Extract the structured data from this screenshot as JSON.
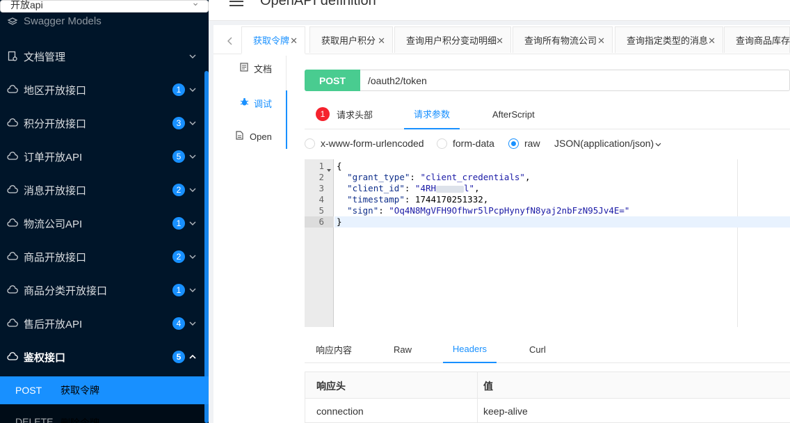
{
  "group_select": {
    "value": "开放api"
  },
  "sidebar": {
    "partial_item": "Swagger Models",
    "items": [
      {
        "label": "文档管理",
        "badge": ""
      },
      {
        "label": "地区开放接口",
        "badge": "1"
      },
      {
        "label": "积分开放接口",
        "badge": "3"
      },
      {
        "label": "订单开放API",
        "badge": "5"
      },
      {
        "label": "消息开放接口",
        "badge": "2"
      },
      {
        "label": "物流公司API",
        "badge": "1"
      },
      {
        "label": "商品开放接口",
        "badge": "2"
      },
      {
        "label": "商品分类开放接口",
        "badge": "1"
      },
      {
        "label": "售后开放API",
        "badge": "4"
      },
      {
        "label": "鉴权接口",
        "badge": "5"
      }
    ],
    "sub_active": {
      "method": "POST",
      "name": "获取令牌"
    },
    "sub_next": {
      "method": "DELETE",
      "name": "删除令牌"
    }
  },
  "header": {
    "title": "OpenAPI definition"
  },
  "tabs": [
    {
      "label": "获取令牌"
    },
    {
      "label": "获取用户积分"
    },
    {
      "label": "查询用户积分变动明细"
    },
    {
      "label": "查询所有物流公司"
    },
    {
      "label": "查询指定类型的消息"
    },
    {
      "label": "查询商品库存"
    }
  ],
  "vertical_tabs": [
    {
      "label": "文档",
      "icon": "document-icon"
    },
    {
      "label": "调试",
      "icon": "bug-icon"
    },
    {
      "label": "Open",
      "icon": "file-icon"
    }
  ],
  "request": {
    "method": "POST",
    "url": "/oauth2/token",
    "method_color": "#49cc90"
  },
  "req_tabs": {
    "headers_count": "1",
    "headers_label": "请求头部",
    "params_label": "请求参数",
    "afterscript_label": "AfterScript"
  },
  "body_type": {
    "options": [
      "x-www-form-urlencoded",
      "form-data",
      "raw"
    ],
    "selected": "raw",
    "content_type": "JSON(application/json)"
  },
  "editor": {
    "line_numbers": [
      "1",
      "2",
      "3",
      "4",
      "5",
      "6"
    ],
    "lines": {
      "open": "{",
      "grant_type_key": "\"grant_type\"",
      "grant_type_val": "\"client_credentials\"",
      "client_id_key": "\"client_id\"",
      "client_id_prefix": "\"4RH",
      "client_id_suffix": "l\"",
      "timestamp_key": "\"timestamp\"",
      "timestamp_val": "1744170251332",
      "sign_key": "\"sign\"",
      "sign_val": "\"Oq4N8MgVFH9Ofhwr5lPcpHynyfN8yaj2nbFzN95Jv4E=\"",
      "close": "}"
    }
  },
  "response_tabs": [
    "响应内容",
    "Raw",
    "Headers",
    "Curl"
  ],
  "response_headers": {
    "col_name": "响应头",
    "col_value": "值",
    "rows": [
      {
        "name": "connection",
        "value": "keep-alive"
      }
    ]
  }
}
